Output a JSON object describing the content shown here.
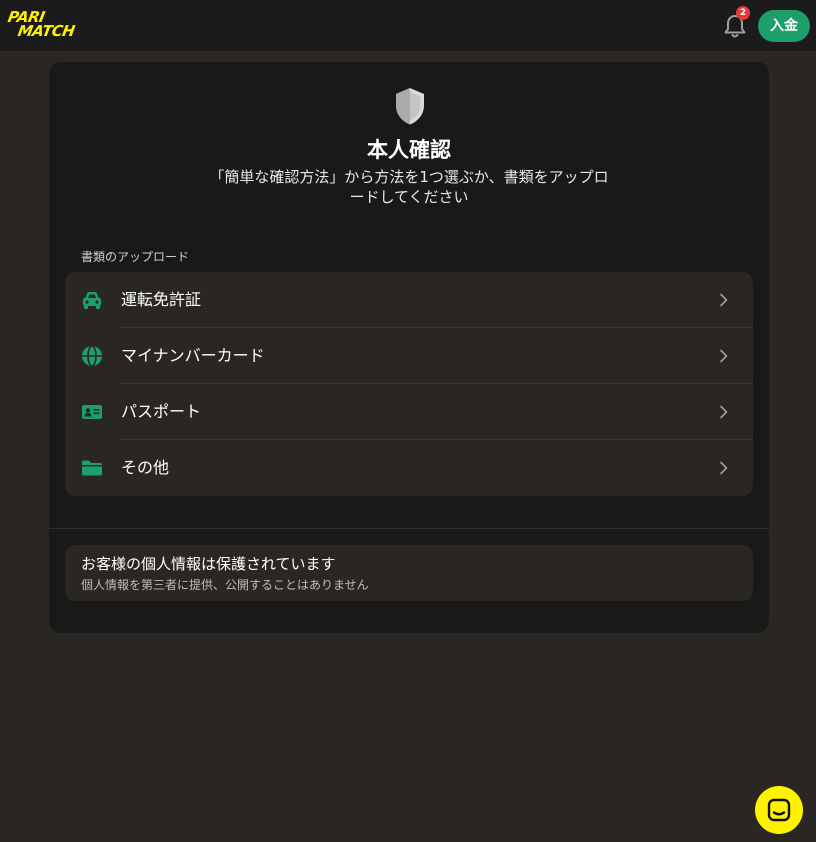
{
  "header": {
    "logo_line1": "PARI",
    "logo_line2": "MATCH",
    "notification_count": "2",
    "deposit_label": "入金"
  },
  "verification": {
    "title": "本人確認",
    "subtitle": "「簡単な確認方法」から方法を1つ選ぶか、書類をアップロードしてください",
    "section_label": "書類のアップロード",
    "items": [
      {
        "label": "運転免許証",
        "icon": "car-icon"
      },
      {
        "label": "マイナンバーカード",
        "icon": "globe-icon"
      },
      {
        "label": "パスポート",
        "icon": "id-card-icon"
      },
      {
        "label": "その他",
        "icon": "folder-icon"
      }
    ],
    "privacy": {
      "title": "お客様の個人情報は保護されています",
      "text": "個人情報を第三者に提供、公開することはありません"
    }
  },
  "colors": {
    "accent_green": "#1e9e6a",
    "brand_yellow": "#fff200",
    "badge_red": "#e53935"
  }
}
